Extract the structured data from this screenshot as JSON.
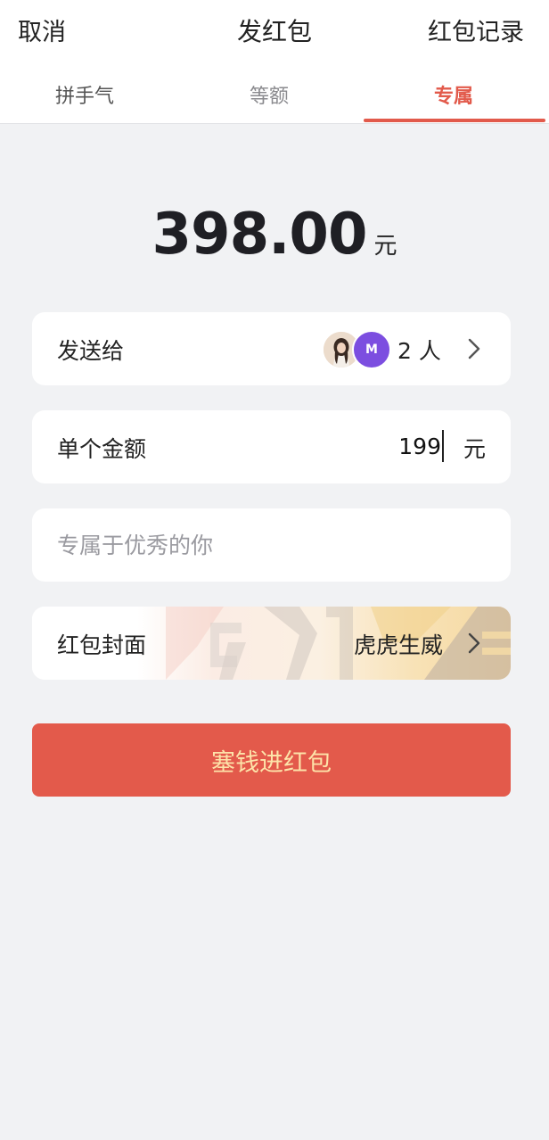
{
  "header": {
    "cancel_label": "取消",
    "title": "发红包",
    "record_label": "红包记录"
  },
  "tabs": [
    {
      "label": "拼手气",
      "active": false
    },
    {
      "label": "等额",
      "active": false
    },
    {
      "label": "专属",
      "active": true
    }
  ],
  "total": {
    "amount": "398.00",
    "unit": "元"
  },
  "recipients": {
    "label": "发送给",
    "avatars": [
      "photo-avatar",
      "M"
    ],
    "count_text": "2 人"
  },
  "single_amount": {
    "label": "单个金额",
    "value": "199",
    "unit": "元"
  },
  "greeting": {
    "placeholder": "专属于优秀的你",
    "value": ""
  },
  "cover": {
    "label": "红包封面",
    "name": "虎虎生威"
  },
  "send_button": {
    "label": "塞钱进红包"
  },
  "colors": {
    "accent": "#e25a4b",
    "button_text": "#fde3a9",
    "background": "#f1f2f4",
    "avatar_m": "#7c4ee0"
  }
}
